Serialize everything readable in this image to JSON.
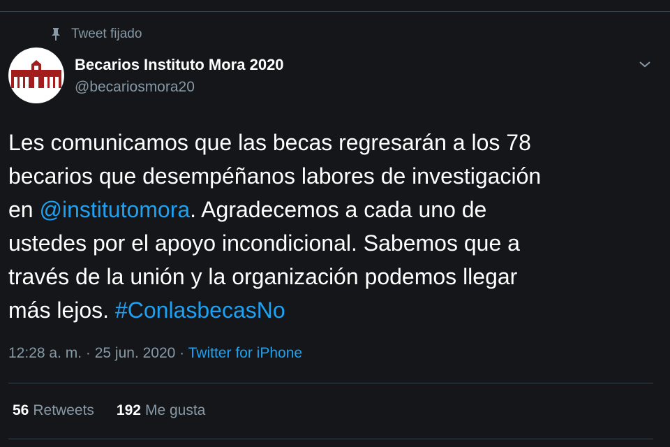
{
  "pinned": {
    "label": "Tweet fijado",
    "icon": "pin-icon"
  },
  "author": {
    "name": "Becarios Instituto Mora 2020",
    "handle": "@becariosmora20",
    "avatar_icon": "institution-building-logo",
    "avatar_color": "#a31d1d"
  },
  "tweet": {
    "lines": [
      [
        "Les comunicamos que las becas regresarán a los 78"
      ],
      [
        "becarios que desempéñanos labores de investigación"
      ],
      [
        "en ",
        "@institutomora",
        ". Agradecemos a cada uno de"
      ],
      [
        "ustedes por el apoyo incondicional. Sabemos que a"
      ],
      [
        "través de la unión y la organización podemos llegar"
      ],
      [
        "más lejos. ",
        "#ConlasbecasNo"
      ]
    ],
    "mention": "@institutomora",
    "hashtag": "#ConlasbecasNo"
  },
  "meta": {
    "time": "12:28 a. m.",
    "separator": " · ",
    "date": "25 jun. 2020",
    "source": "Twitter for iPhone"
  },
  "stats": {
    "retweets_count": "56",
    "retweets_label": "Retweets",
    "likes_count": "192",
    "likes_label": "Me gusta"
  },
  "colors": {
    "background": "#141619",
    "link": "#1da1f2",
    "muted": "#8899a6",
    "border": "#38444d"
  }
}
